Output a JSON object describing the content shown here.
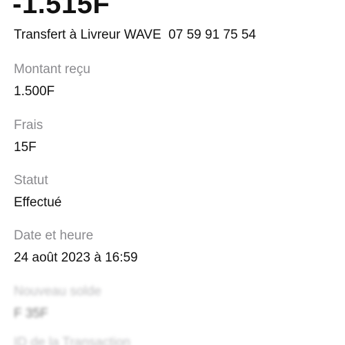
{
  "transaction": {
    "amount": "-1.515F",
    "description": "Transfert à Livreur WAVE  07 59 91 75 54"
  },
  "details": {
    "received_label": "Montant reçu",
    "received_value": "1.500F",
    "fees_label": "Frais",
    "fees_value": "15F",
    "status_label": "Statut",
    "status_value": "Effectué",
    "datetime_label": "Date et heure",
    "datetime_value": "24 août 2023 à 16:59",
    "balance_label": "Nouveau solde",
    "balance_value": "F 35F",
    "transaction_id_label": "ID de la Transaction"
  }
}
